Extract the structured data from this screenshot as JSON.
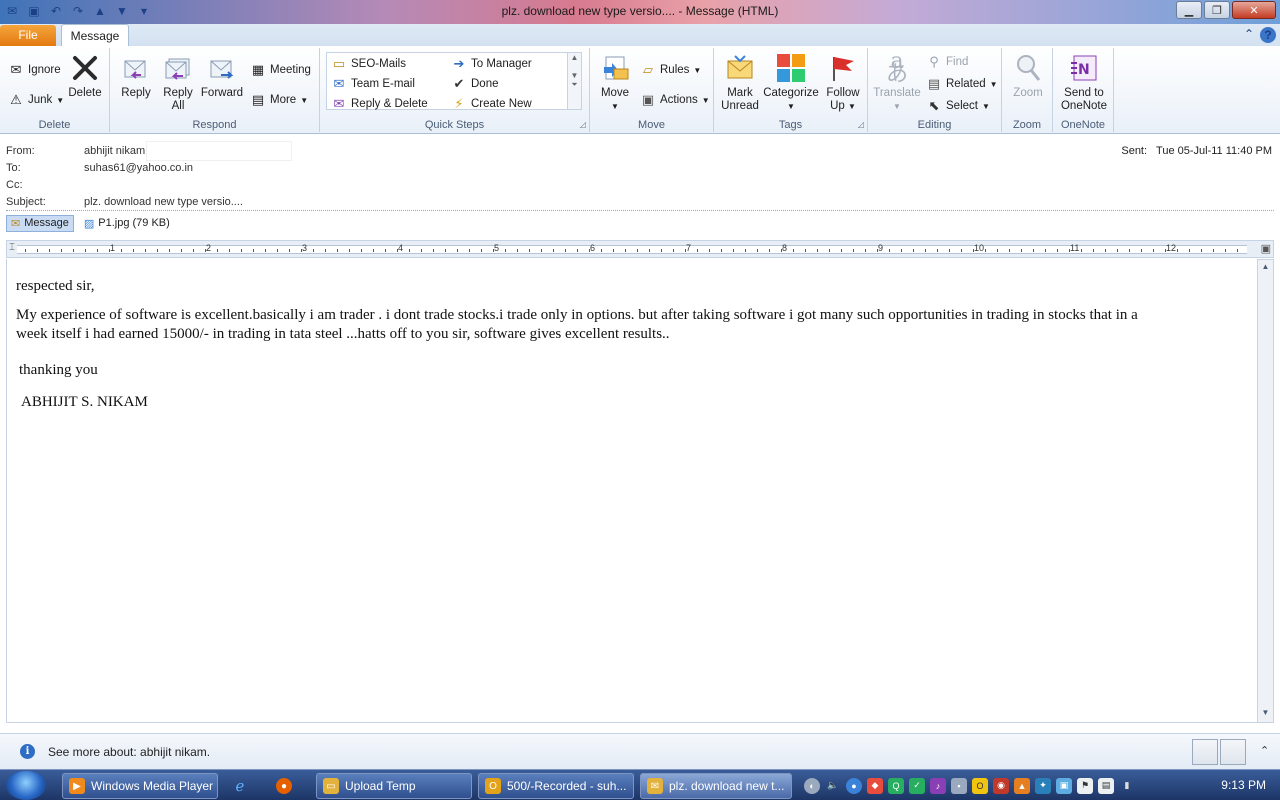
{
  "window": {
    "title": "plz. download new type versio.... -  Message (HTML)"
  },
  "ribbon": {
    "tabs": {
      "file": "File",
      "message": "Message"
    },
    "groups": {
      "delete": {
        "label": "Delete",
        "ignore": "Ignore",
        "junk": "Junk",
        "delete": "Delete"
      },
      "respond": {
        "label": "Respond",
        "reply": "Reply",
        "reply_all_1": "Reply",
        "reply_all_2": "All",
        "forward": "Forward",
        "meeting": "Meeting",
        "more": "More"
      },
      "quick_steps": {
        "label": "Quick Steps",
        "items": [
          "SEO-Mails",
          "To Manager",
          "Team E-mail",
          "Done",
          "Reply & Delete",
          "Create New"
        ]
      },
      "move": {
        "label": "Move",
        "move": "Move",
        "rules": "Rules",
        "actions": "Actions"
      },
      "tags": {
        "label": "Tags",
        "mark_unread_1": "Mark",
        "mark_unread_2": "Unread",
        "categorize": "Categorize",
        "follow_up_1": "Follow",
        "follow_up_2": "Up"
      },
      "editing": {
        "label": "Editing",
        "translate": "Translate",
        "find": "Find",
        "related": "Related",
        "select": "Select"
      },
      "zoom": {
        "label": "Zoom",
        "zoom": "Zoom"
      },
      "onenote": {
        "label": "OneNote",
        "send_1": "Send to",
        "send_2": "OneNote"
      }
    }
  },
  "header": {
    "from_label": "From:",
    "from_value": "abhijit nikam",
    "to_label": "To:",
    "to_value": "suhas61@yahoo.co.in",
    "cc_label": "Cc:",
    "subject_label": "Subject:",
    "subject_value": "plz. download new type versio....",
    "sent_label": "Sent:",
    "sent_value": "Tue 05-Jul-11 11:40 PM"
  },
  "attachments": {
    "message": "Message",
    "file": "P1.jpg (79 KB)"
  },
  "ruler": {
    "numbers": [
      "1",
      "2",
      "3",
      "4",
      "5",
      "6",
      "7",
      "8",
      "9",
      "10",
      "11",
      "12"
    ]
  },
  "body": {
    "greeting": "respected sir,",
    "paragraph_line1": "My experience of software is excellent.basically i am trader . i dont trade stocks.i trade only in options. but after taking software i got many such opportunities in trading in stocks that in a",
    "paragraph_line2": "week itself i had earned 15000/- in trading in tata steel ...hatts off to you sir, software gives excellent results..",
    "closing": "thanking you",
    "signature": "ABHIJIT S. NIKAM"
  },
  "people_pane": {
    "text": "See more about: abhijit nikam."
  },
  "taskbar": {
    "items": [
      "Windows Media Player",
      "Upload Temp",
      "500/-Recorded - suh...",
      "plz. download new t..."
    ],
    "clock": "9:13 PM"
  }
}
